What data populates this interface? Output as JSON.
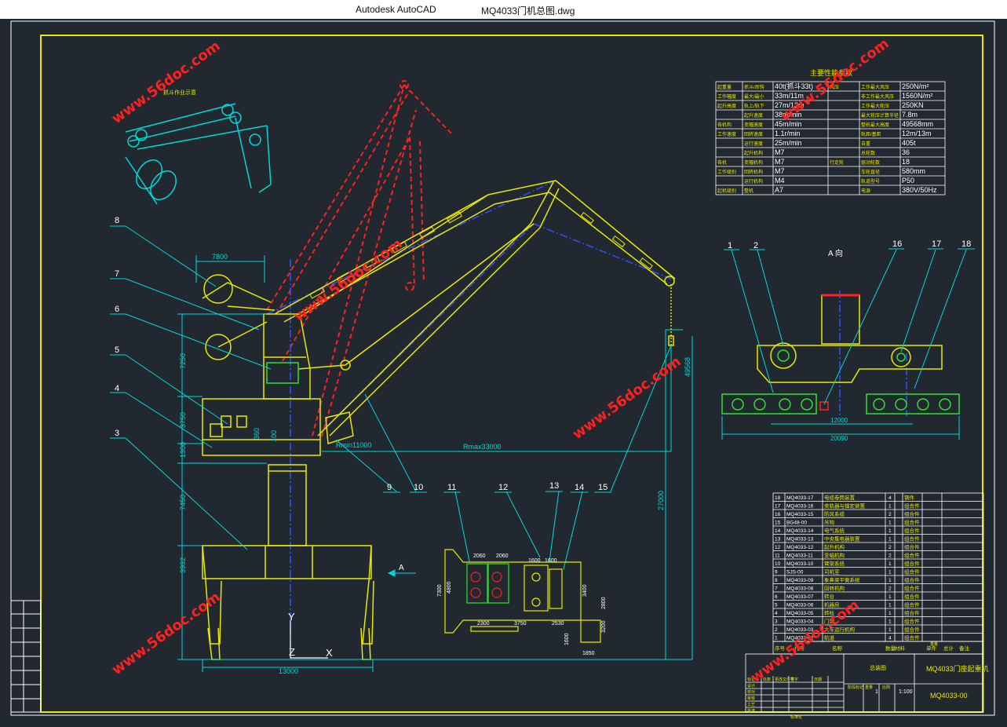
{
  "titlebar": {
    "app_name": "Autodesk AutoCAD",
    "file_name": "MQ4033门机总图.dwg"
  },
  "colors": {
    "background": "#212830",
    "frame": "#e8e800",
    "dim": "#00d8d8",
    "hidden": "#ff2020",
    "center": "#3050ff",
    "watermark": "#ff2020",
    "green": "#30e030"
  },
  "watermark_text": "www.56doc.com",
  "balloons": [
    "1",
    "2",
    "3",
    "4",
    "5",
    "6",
    "7",
    "8",
    "9",
    "10",
    "11",
    "12",
    "13",
    "14",
    "15",
    "16",
    "17",
    "18"
  ],
  "dims": {
    "d7800": "7800",
    "d7250": "7250",
    "d3750": "3750",
    "d1300": "1300",
    "d7450": "7450",
    "d3932": "3932",
    "d13000": "13000",
    "d27000": "27000",
    "d49568": "49568",
    "rmin": "Rmin11000",
    "rmax": "Rmax33000",
    "d360": "360",
    "d100": "100",
    "d12000": "12000",
    "d20090": "20090",
    "d2060a": "2060",
    "d2060b": "2060",
    "d1600a": "1600",
    "d1600b": "1600",
    "d7300": "7300",
    "d4800": "4800",
    "d2300": "2300",
    "d3750b": "3750",
    "d2530": "2530",
    "d3400": "3400",
    "d2800": "2800",
    "d3200": "3200",
    "d1600c": "1600",
    "d1850": "1850"
  },
  "view_label": "A 向",
  "arrow_label": "A",
  "axis_labels": {
    "y": "Y",
    "z": "Z",
    "x": "X"
  },
  "param_table": {
    "title": "主要性能参数",
    "rows": [
      [
        "起重量",
        "抓斗/吊钩",
        "40t(抓斗33t)",
        "风压",
        "工作最大风压",
        "250N/m²"
      ],
      [
        "工作幅度",
        "最大/最小",
        "33m/11m",
        "",
        "非工作最大风压",
        "1560N/m²"
      ],
      [
        "起升高度",
        "轨上/轨下",
        "27m/13m",
        "",
        "工作最大轮压",
        "250KN"
      ],
      [
        "",
        "起升速度",
        "38m/min",
        "",
        "最大轮压计算半径",
        "7.8m"
      ],
      [
        "各机构",
        "变幅速度",
        "45m/min",
        "",
        "整机最大高度",
        "49568mm"
      ],
      [
        "工作速度",
        "回转速度",
        "1.1r/min",
        "",
        "轨距/基距",
        "12m/13m"
      ],
      [
        "",
        "运行速度",
        "25m/min",
        "",
        "自重",
        "405t"
      ],
      [
        "",
        "起升机构",
        "M7",
        "",
        "总轮数",
        "36"
      ],
      [
        "各机",
        "变幅机构",
        "M7",
        "行走轮",
        "驱动轮数",
        "18"
      ],
      [
        "工作级别",
        "回转机构",
        "M7",
        "",
        "车轮直径",
        "580mm"
      ],
      [
        "",
        "运行机构",
        "M4",
        "",
        "轨道型号",
        "P50"
      ],
      [
        "起机级别",
        "整机",
        "A7",
        "",
        "电源",
        "380V/50Hz"
      ]
    ]
  },
  "bom_table": {
    "rows": [
      [
        "18",
        "MQ4033-17",
        "电缆卷筒装置",
        "4",
        "钢件"
      ],
      [
        "17",
        "MQ4033-16",
        "夹轨器与锚定装置",
        "1",
        "组合件"
      ],
      [
        "16",
        "MQ4033-15",
        "防风系缆",
        "2",
        "组合件"
      ],
      [
        "15",
        "BG48-00",
        "吊钩",
        "1",
        "组合件"
      ],
      [
        "14",
        "MQ4033-14",
        "电气系统",
        "1",
        "组合件"
      ],
      [
        "13",
        "MQ4033-13",
        "中央集电器装置",
        "1",
        "组合件"
      ],
      [
        "12",
        "MQ4033-12",
        "起升机构",
        "2",
        "组合件"
      ],
      [
        "11",
        "MQ4033-11",
        "变幅机构",
        "2",
        "组合件"
      ],
      [
        "10",
        "MQ4033-10",
        "臂架系统",
        "1",
        "组合件"
      ],
      [
        "9",
        "SJS-00",
        "司机室",
        "1",
        "组合件"
      ],
      [
        "8",
        "MQ4033-09",
        "象鼻梁平衡系统",
        "1",
        "组合件"
      ],
      [
        "7",
        "MQ4033-08",
        "回转机构",
        "2",
        "组合件"
      ],
      [
        "6",
        "MQ4033-07",
        "转台",
        "1",
        "组合件"
      ],
      [
        "5",
        "MQ4033-06",
        "机器房",
        "1",
        "组合件"
      ],
      [
        "4",
        "MQ4033-05",
        "转柱",
        "1",
        "组合件"
      ],
      [
        "3",
        "MQ4033-04",
        "门架",
        "1",
        "组合件"
      ],
      [
        "2",
        "MQ4033-03",
        "大车运行机构",
        "1",
        "组合件"
      ],
      [
        "1",
        "MQ4033-02",
        "轨道",
        "4",
        "组合件"
      ]
    ],
    "header": [
      "序号",
      "代号",
      "名称",
      "数量",
      "材料",
      "单件",
      "总计",
      "备注"
    ],
    "weight_header": "重量",
    "assembly": "总装图",
    "drawing_title": "MQ4033门座起重机",
    "drawing_no": "MQ4033-00",
    "scale": "1:100",
    "sign_labels": [
      "标记",
      "处数",
      "更改文件号",
      "签字",
      "日期",
      "设计",
      "校对",
      "审核",
      "工艺",
      "批准",
      "标准化"
    ],
    "stage_labels": [
      "阶段标记",
      "重量",
      "比例"
    ],
    "sheet": "1"
  },
  "inset_label": "抓斗作业示意"
}
